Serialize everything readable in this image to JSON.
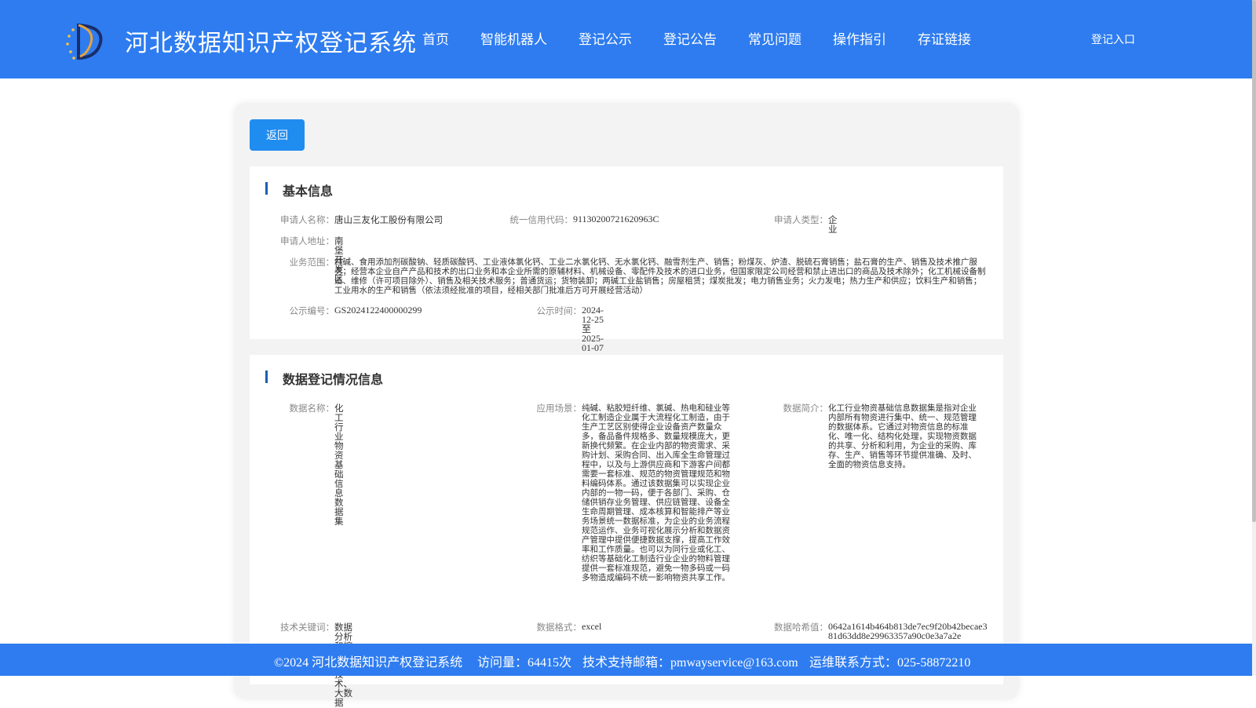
{
  "header": {
    "title": "河北数据知识产权登记系统",
    "nav": [
      "首页",
      "智能机器人",
      "登记公示",
      "登记公告",
      "常见问题",
      "操作指引",
      "存证链接"
    ],
    "login_label": "登记入口"
  },
  "back_label": "返回",
  "basic": {
    "section_title": "基本信息",
    "applicant_name_label": "申请人名称：",
    "applicant_name": "唐山三友化工股份有限公司",
    "credit_code_label": "统一信用代码：",
    "credit_code": "91130200721620963C",
    "applicant_type_label": "申请人类型：",
    "applicant_type": "企业",
    "address_label": "申请人地址：",
    "address": "南堡开发区",
    "scope_label": "业务范围：",
    "scope": "纯碱、食用添加剂碳酸钠、轻质碳酸钙、工业液体氯化钙、工业二水氯化钙、无水氯化钙、融雪剂生产、销售；粉煤灰、炉渣、脱硫石膏销售；盐石膏的生产、销售及技术推广服务；经营本企业自产产品和技术的出口业务和本企业所需的原辅材料、机械设备、零配件及技术的进口业务，但国家限定公司经营和禁止进出口的商品及技术除外；化工机械设备制造、维修（许可项目除外）、销售及相关技术服务；普通货运；货物装卸；两碱工业盐销售；房屋租赁；煤炭批发；电力销售业务；火力发电；热力生产和供应；饮料生产和销售；工业用水的生产和销售（依法须经批准的项目，经相关部门批准后方可开展经营活动）",
    "pub_no_label": "公示编号：",
    "pub_no": "GS2024122400000299",
    "pub_time_label": "公示时间：",
    "pub_time": "2024-12-25至2025-01-07"
  },
  "data_reg": {
    "section_title": "数据登记情况信息",
    "data_name_label": "数据名称：",
    "data_name": "化工行业物资基础信息数据集",
    "scenario_label": "应用场景：",
    "scenario": "纯碱、粘胶短纤维、氯碱、热电和硅业等化工制造企业属于大流程化工制造，由于生产工艺区别使得企业设备资产数量众多，备品备件规格多、数量规模庞大，更新换代频繁。在企业内部的物资需求、采购计划、采购合同、出入库全生命管理过程中，以及与上游供应商和下游客户间都需要一套标准、规范的物资管理规范和物料编码体系。通过该数据集可以实现企业内部的一物一码，便于各部门、采购、仓储供销存业务管理、供应链管理、设备全生命周期管理、成本核算和智能排产等业务场景统一数据标准，为企业的业务流程规范运作、业务可视化展示分析和数据资产管理中提供便捷数据支撑，提高工作效率和工作质量。也可以为同行业或化工、纺织等基础化工制造行业企业的物料管理提供一套标准规范，避免一物多码或一码多物造成编码不统一影响物资共享工作。",
    "intro_label": "数据简介：",
    "intro": "化工行业物资基础信息数据集是指对企业内部所有物资进行集中、统一、规范管理的数据体系。它通过对物资信息的标准化、唯一化、结构化处理，实现物资数据的共享、分析和利用，为企业的采购、库存、生产、销售等环节提供准确、及时、全面的物资信息支持。",
    "keywords_label": "技术关键词：",
    "keywords": "数据分析和挖掘、RFID技术、大数据",
    "format_label": "数据格式：",
    "format": "excel",
    "hash_label": "数据哈希值：",
    "hash": "0642a1614b464b813de7ec9f20b42becae381d63dd8e29963357a90c0e3a7a2e"
  },
  "footer": {
    "copyright": "©2024 河北数据知识产权登记系统",
    "visits": "访问量：64415次",
    "email": "技术支持邮箱：pmwayservice@163.com",
    "phone": "运维联系方式：025-58872210"
  },
  "colors": {
    "header_bg": "#2e7cf0",
    "button_bg": "#1f8cf0",
    "section_marker": "#1a5fb4"
  }
}
